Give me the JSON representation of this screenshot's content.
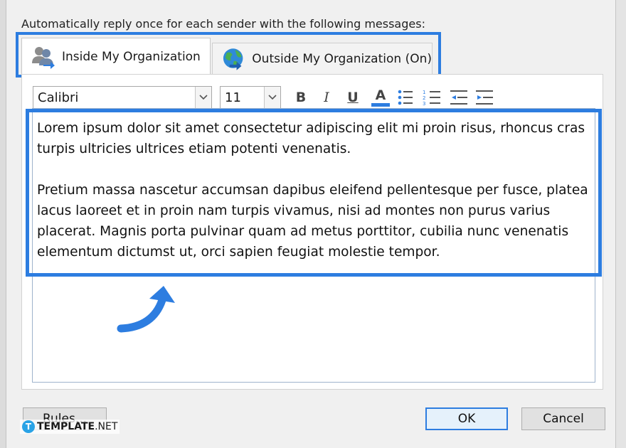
{
  "dialog": {
    "instruction": "Automatically reply once for each sender with the following messages:"
  },
  "tabs": [
    {
      "label": "Inside My Organization",
      "icon": "people-icon",
      "selected": true
    },
    {
      "label": "Outside My Organization (On)",
      "icon": "globe-icon",
      "selected": false
    }
  ],
  "toolbar": {
    "font_family": "Calibri",
    "font_size": "11",
    "bold": "B",
    "italic": "I",
    "underline": "U",
    "font_color": "A",
    "font_color_value": "#2d7de0",
    "bullets_icon": "bullet-list-icon",
    "numbering_icon": "numbered-list-icon",
    "decrease_indent_icon": "decrease-indent-icon",
    "increase_indent_icon": "increase-indent-icon"
  },
  "message": {
    "paragraphs": [
      "Lorem ipsum dolor sit amet consectetur adipiscing elit mi proin risus, rhoncus cras turpis ultricies ultrices etiam potenti venenatis.",
      "Pretium massa nascetur accumsan dapibus eleifend pellentesque per fusce, platea lacus laoreet et in proin nam turpis vivamus, nisi ad montes non purus varius placerat. Magnis porta pulvinar quam ad metus porttitor, cubilia nunc venenatis elementum dictumst ut, orci sapien feugiat molestie tempor."
    ]
  },
  "buttons": {
    "rules": "Rules...",
    "ok": "OK",
    "cancel": "Cancel"
  },
  "watermark": {
    "brand": "TEMPLATE",
    "suffix": ".NET"
  },
  "colors": {
    "highlight": "#2d7de0",
    "dialog_bg": "#f0f0f0"
  }
}
